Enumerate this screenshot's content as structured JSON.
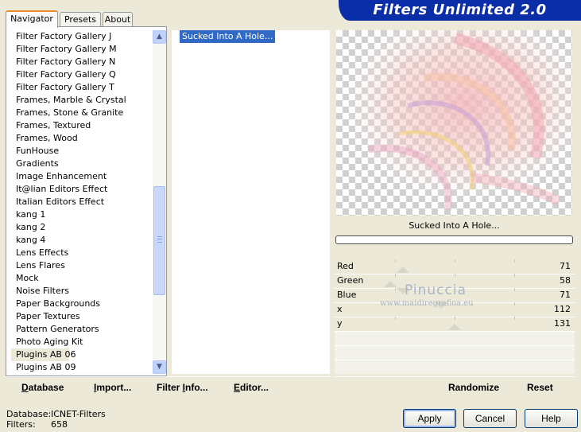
{
  "app": {
    "title": "Filters Unlimited 2.0"
  },
  "tabs": [
    {
      "label": "Navigator",
      "active": true
    },
    {
      "label": "Presets",
      "active": false
    },
    {
      "label": "About",
      "active": false
    }
  ],
  "categories": {
    "items": [
      "Filter Factory Gallery J",
      "Filter Factory Gallery M",
      "Filter Factory Gallery N",
      "Filter Factory Gallery Q",
      "Filter Factory Gallery T",
      "Frames, Marble & Crystal",
      "Frames, Stone & Granite",
      "Frames, Textured",
      "Frames, Wood",
      "FunHouse",
      "Gradients",
      "Image Enhancement",
      "It@lian Editors Effect",
      "Italian Editors Effect",
      "kang 1",
      "kang 2",
      "kang 4",
      "Lens Effects",
      "Lens Flares",
      "Mock",
      "Noise Filters",
      "Paper Backgrounds",
      "Paper Textures",
      "Pattern Generators",
      "Photo Aging Kit",
      "Plugins AB 06",
      "Plugins AB 09"
    ],
    "selected": "Plugins AB 06"
  },
  "scrollbar": {
    "up_icon": "scroll-up-arrow-icon",
    "down_icon": "scroll-down-arrow-icon",
    "up_glyph": "▲",
    "down_glyph": "▼"
  },
  "filters": {
    "selected": "Sucked Into A Hole..."
  },
  "preview": {
    "caption": "Sucked Into A Hole..."
  },
  "sliders": [
    {
      "label": "Red",
      "value": "71"
    },
    {
      "label": "Green",
      "value": "58"
    },
    {
      "label": "Blue",
      "value": "71"
    },
    {
      "label": "x",
      "value": "112"
    },
    {
      "label": "y",
      "value": "131"
    }
  ],
  "watermark": {
    "name": "Pinuccia",
    "url": "www.maidiregrafica.eu"
  },
  "left_buttons": {
    "database": {
      "u": "D",
      "rest": "atabase"
    },
    "import": {
      "pre": "",
      "u": "I",
      "rest": "mport..."
    },
    "filter_info": {
      "pre": "Filter ",
      "u": "I",
      "rest": "nfo..."
    },
    "editor": {
      "pre": "",
      "u": "E",
      "rest": "ditor..."
    }
  },
  "right_buttons": {
    "randomize": "Randomize",
    "reset": "Reset"
  },
  "status": {
    "database_label": "Database:",
    "database_value": "ICNET-Filters",
    "filters_label": "Filters:",
    "filters_value": "658"
  },
  "dialog_buttons": {
    "apply": "Apply",
    "cancel": "Cancel",
    "help": "Help"
  },
  "colors": {
    "banner": "#0a2ea8",
    "selection": "#316ac5",
    "dialog_bg": "#ece9d8"
  }
}
